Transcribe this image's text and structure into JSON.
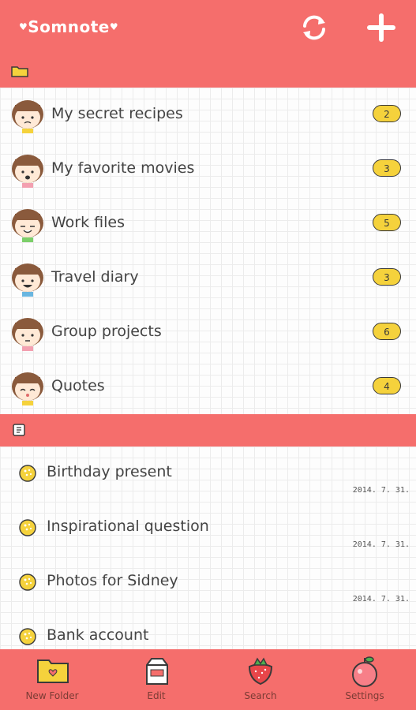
{
  "app": {
    "logo": "Somnote"
  },
  "folders": [
    {
      "name": "My secret recipes",
      "count": "2"
    },
    {
      "name": "My favorite movies",
      "count": "3"
    },
    {
      "name": "Work files",
      "count": "5"
    },
    {
      "name": "Travel diary",
      "count": "3"
    },
    {
      "name": "Group projects",
      "count": "6"
    },
    {
      "name": "Quotes",
      "count": "4"
    }
  ],
  "notes": [
    {
      "title": "Birthday present",
      "date": "2014. 7. 31."
    },
    {
      "title": "Inspirational question",
      "date": "2014. 7. 31."
    },
    {
      "title": "Photos for Sidney",
      "date": "2014. 7. 31."
    },
    {
      "title": "Bank account",
      "date": ""
    }
  ],
  "tabs": [
    {
      "label": "New Folder"
    },
    {
      "label": "Edit"
    },
    {
      "label": "Search"
    },
    {
      "label": "Settings"
    }
  ],
  "colors": {
    "accent": "#f56e6c",
    "badge": "#f5d23c"
  }
}
